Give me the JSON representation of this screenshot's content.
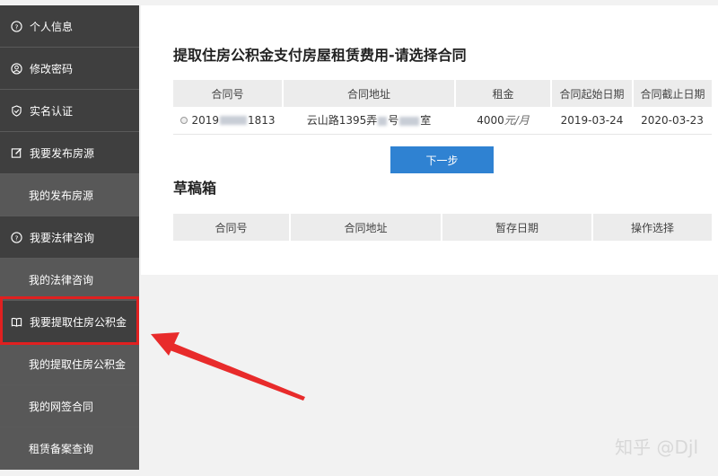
{
  "sidebar": {
    "items": [
      {
        "label": "个人信息",
        "icon": "question-circle-icon"
      },
      {
        "label": "修改密码",
        "icon": "user-circle-icon"
      },
      {
        "label": "实名认证",
        "icon": "shield-icon"
      },
      {
        "label": "我要发布房源",
        "icon": "edit-icon"
      },
      {
        "label": "我的发布房源"
      },
      {
        "label": "我要法律咨询",
        "icon": "question-circle-icon"
      },
      {
        "label": "我的法律咨询"
      },
      {
        "label": "我要提取住房公积金",
        "icon": "book-icon"
      },
      {
        "label": "我的提取住房公积金"
      },
      {
        "label": "我的网签合同"
      },
      {
        "label": "租赁备案查询"
      }
    ]
  },
  "main": {
    "title": "提取住房公积金支付房屋租赁费用-请选择合同",
    "contracts_table": {
      "headers": [
        "合同号",
        "合同地址",
        "租金",
        "合同起始日期",
        "合同截止日期"
      ],
      "rows": [
        {
          "contract_no_prefix": "2019",
          "contract_no_suffix": "1813",
          "address_part1": "云山路1395弄",
          "address_part2": "号",
          "address_part3": "室",
          "rent": "4000",
          "rent_unit": "元/月",
          "start_date": "2019-03-24",
          "end_date": "2020-03-23"
        }
      ]
    },
    "next_button": "下一步",
    "drafts_title": "草稿箱",
    "drafts_table": {
      "headers": [
        "合同号",
        "合同地址",
        "暂存日期",
        "操作选择"
      ]
    }
  },
  "watermark": "知乎 @Djl",
  "colors": {
    "sidebar_bg": "#3d3d3d",
    "sidebar_sub_bg": "#585858",
    "highlight_red": "#e02020",
    "button_blue": "#2f82d2"
  }
}
